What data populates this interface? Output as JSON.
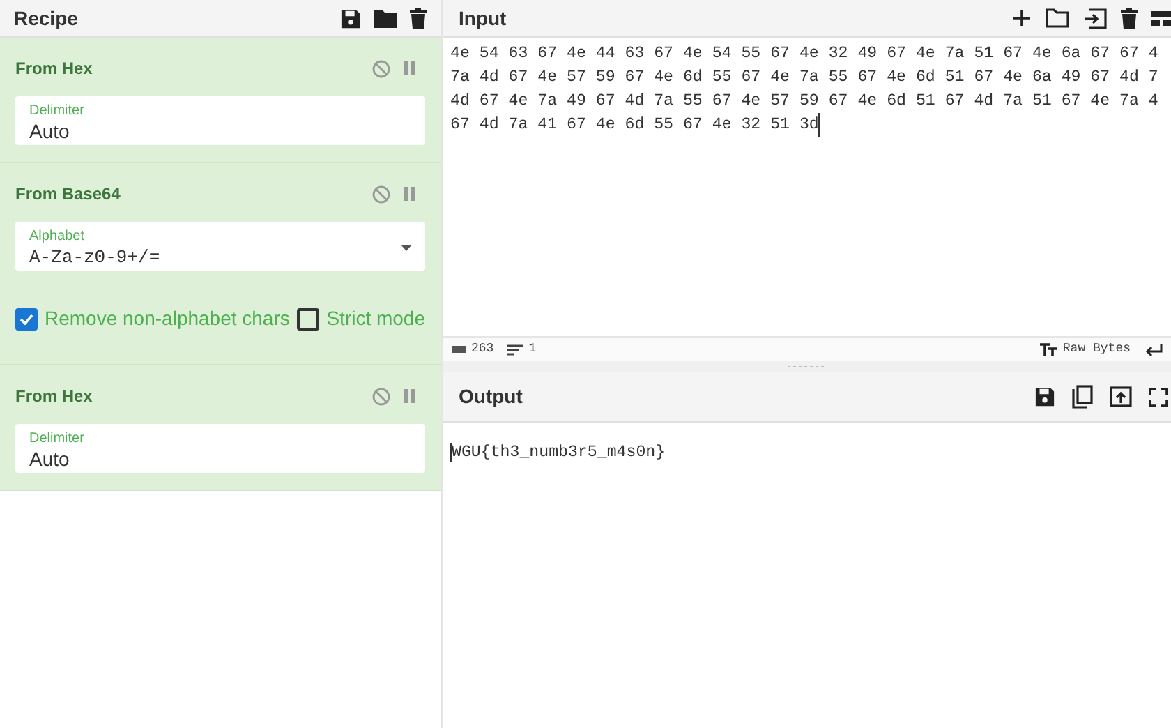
{
  "recipe": {
    "title": "Recipe",
    "operations": [
      {
        "kind": "field",
        "name": "From Hex",
        "fields": [
          {
            "label": "Delimiter",
            "value": "Auto",
            "dropdown": false
          }
        ]
      },
      {
        "kind": "field",
        "name": "From Base64",
        "fields": [
          {
            "label": "Alphabet",
            "value": "A-Za-z0-9+/=",
            "dropdown": true
          }
        ],
        "options": [
          {
            "label": "Remove non-alphabet chars",
            "checked": true
          },
          {
            "label": "Strict mode",
            "checked": false
          }
        ]
      },
      {
        "kind": "field",
        "name": "From Hex",
        "fields": [
          {
            "label": "Delimiter",
            "value": "Auto",
            "dropdown": false
          }
        ]
      }
    ]
  },
  "input": {
    "title": "Input",
    "lines": [
      "4e 54 63 67 4e 44 63 67 4e 54 55 67 4e 32 49 67 4e 7a 51 67 4e 6a 67 67 4",
      "7a 4d 67 4e 57 59 67 4e 6d 55 67 4e 7a 55 67 4e 6d 51 67 4e 6a 49 67 4d 7",
      "4d 67 4e 7a 49 67 4d 7a 55 67 4e 57 59 67 4e 6d 51 67 4d 7a 51 67 4e 7a 4",
      "67 4d 7a 41 67 4e 6d 55 67 4e 32 51 3d"
    ]
  },
  "status_bar": {
    "chars": "263",
    "lines": "1",
    "encoding": "Raw Bytes"
  },
  "output": {
    "title": "Output",
    "text": "WGU{th3_numb3r5_m4s0n}"
  }
}
